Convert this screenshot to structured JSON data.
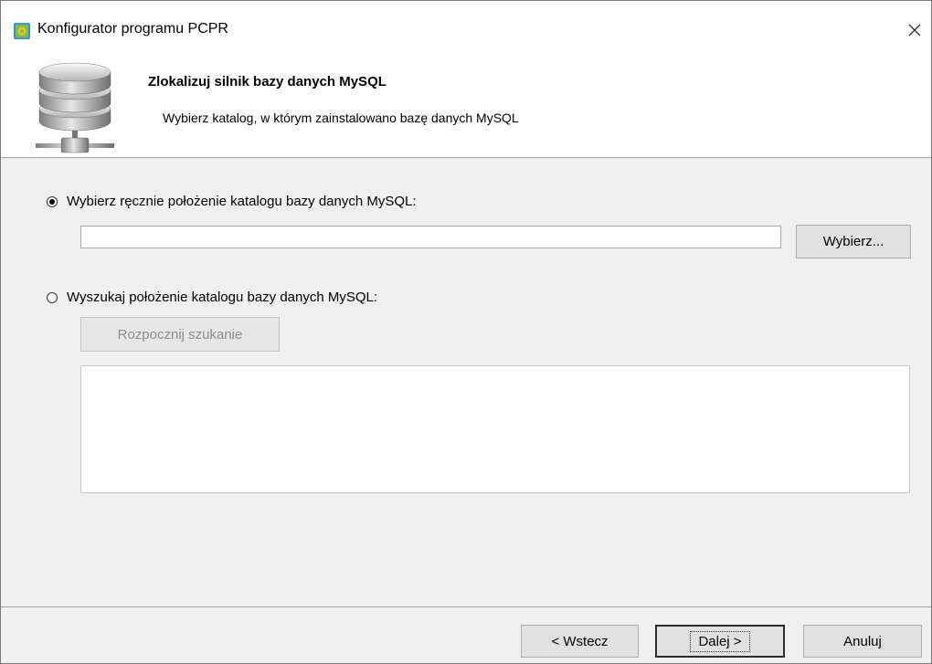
{
  "window": {
    "title": "Konfigurator programu PCPR",
    "app_icon": "gear-app-icon",
    "close_icon": "close-icon"
  },
  "header": {
    "title": "Zlokalizuj silnik bazy danych MySQL",
    "subtitle": "Wybierz katalog, w którym zainstalowano bazę danych MySQL",
    "icon": "database-network-icon"
  },
  "manual": {
    "label": "Wybierz ręcznie położenie katalogu bazy danych MySQL:",
    "selected": true,
    "path_value": "",
    "browse_label": "Wybierz..."
  },
  "search": {
    "label": "Wyszukaj położenie katalogu bazy danych MySQL:",
    "selected": false,
    "start_label": "Rozpocznij szukanie",
    "results": []
  },
  "footer": {
    "back_label": "< Wstecz",
    "next_label": "Dalej >",
    "cancel_label": "Anuluj"
  }
}
